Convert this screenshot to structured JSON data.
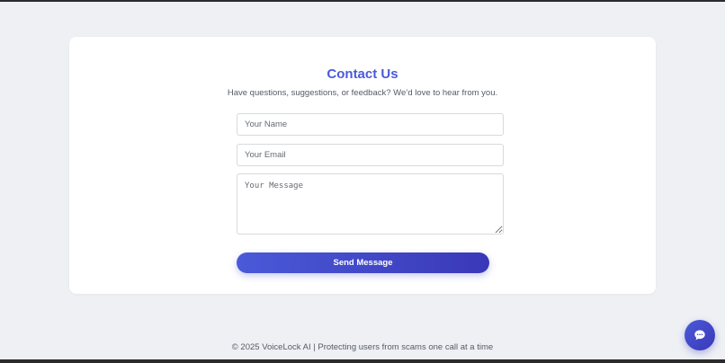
{
  "contact": {
    "title": "Contact Us",
    "subtitle": "Have questions, suggestions, or feedback? We’d love to hear from you.",
    "name_placeholder": "Your Name",
    "name_value": "",
    "email_placeholder": "Your Email",
    "email_value": "",
    "message_placeholder": "Your Message",
    "message_value": "",
    "send_label": "Send Message"
  },
  "footer": {
    "text": "© 2025 VoiceLock AI | Protecting users from scams one call at a time"
  },
  "chat_widget": {
    "icon": "chat-bubble-icon"
  },
  "colors": {
    "accent": "#4a5ad8",
    "accent_dark": "#3a38b8",
    "page_background": "#eef0f4",
    "card_background": "#ffffff"
  }
}
